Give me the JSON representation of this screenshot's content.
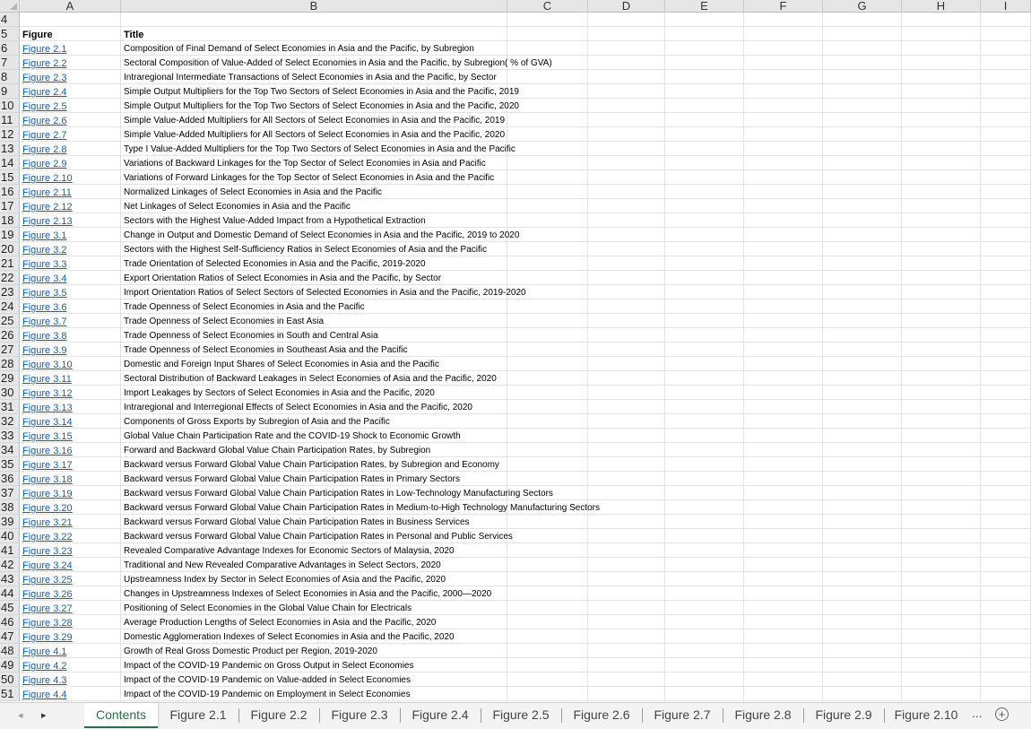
{
  "columns": [
    "A",
    "B",
    "C",
    "D",
    "E",
    "F",
    "G",
    "H",
    "I"
  ],
  "first_row_number": "4",
  "header_row": {
    "number": "5",
    "figure_label": "Figure",
    "title_label": "Title"
  },
  "rows": [
    {
      "number": "6",
      "figure": "Figure 2.1",
      "title": "Composition of Final Demand of Select Economies in Asia and the Pacific, by Subregion"
    },
    {
      "number": "7",
      "figure": "Figure 2.2",
      "title": "Sectoral Composition of Value-Added of Select Economies in Asia and the Pacific, by Subregion( % of GVA)"
    },
    {
      "number": "8",
      "figure": "Figure 2.3",
      "title": "Intraregional Intermediate Transactions of Select Economies in Asia and the Pacific, by Sector"
    },
    {
      "number": "9",
      "figure": "Figure 2.4",
      "title": "Simple Output Multipliers for the Top Two Sectors of Select Economies in Asia and the Pacific, 2019"
    },
    {
      "number": "10",
      "figure": "Figure 2.5",
      "title": "Simple Output Multipliers for the Top Two Sectors of Select Economies in Asia and the Pacific, 2020"
    },
    {
      "number": "11",
      "figure": "Figure 2.6",
      "title": "Simple Value-Added Multipliers for All Sectors of Select Economies in Asia and the Pacific, 2019"
    },
    {
      "number": "12",
      "figure": "Figure 2.7",
      "title": "Simple Value-Added Multipliers for All Sectors of Select Economies in Asia and the Pacific, 2020"
    },
    {
      "number": "13",
      "figure": "Figure 2.8",
      "title": "Type I Value-Added Multipliers for the Top Two Sectors of Select Economies in Asia and the Pacific"
    },
    {
      "number": "14",
      "figure": "Figure 2.9",
      "title": "Variations of Backward Linkages for the Top Sector of Select Economies in Asia and Pacific"
    },
    {
      "number": "15",
      "figure": "Figure 2.10",
      "title": "Variations of Forward Linkages for the Top Sector of Select Economies in Asia and the Pacific"
    },
    {
      "number": "16",
      "figure": "Figure 2.11",
      "title": "Normalized Linkages of Select Economies in Asia and the Pacific"
    },
    {
      "number": "17",
      "figure": "Figure 2.12",
      "title": "Net Linkages of Select Economies in Asia and the Pacific"
    },
    {
      "number": "18",
      "figure": "Figure 2.13",
      "title": "Sectors with the Highest Value-Added Impact from a Hypothetical Extraction"
    },
    {
      "number": "19",
      "figure": "Figure 3.1",
      "title": "Change in Output and Domestic Demand of Select Economies in Asia and the Pacific, 2019 to 2020"
    },
    {
      "number": "20",
      "figure": "Figure 3.2",
      "title": "Sectors with the Highest Self-Sufficiency Ratios in Select Economies of Asia and the Pacific"
    },
    {
      "number": "21",
      "figure": "Figure 3.3",
      "title": "Trade Orientation of Selected Economies in Asia and the Pacific, 2019-2020"
    },
    {
      "number": "22",
      "figure": "Figure 3.4",
      "title": "Export Orientation Ratios of Select Economies in Asia and the Pacific, by Sector"
    },
    {
      "number": "23",
      "figure": "Figure 3.5",
      "title": "Import Orientation Ratios of Select Sectors of Selected Economies in Asia and the Pacific, 2019-2020"
    },
    {
      "number": "24",
      "figure": "Figure 3.6",
      "title": "Trade Openness of Select Economies in Asia and the Pacific"
    },
    {
      "number": "25",
      "figure": "Figure 3.7",
      "title": "Trade Openness of Select Economies in East Asia"
    },
    {
      "number": "26",
      "figure": "Figure 3.8",
      "title": "Trade Openness of Select Economies in South and Central Asia"
    },
    {
      "number": "27",
      "figure": "Figure 3.9",
      "title": "Trade Openness of Select Economies in Southeast Asia and the Pacific"
    },
    {
      "number": "28",
      "figure": "Figure 3.10",
      "title": "Domestic and Foreign Input Shares of Select Economies in Asia and the Pacific"
    },
    {
      "number": "29",
      "figure": "Figure 3.11",
      "title": "Sectoral Distribution of Backward Leakages in Select Economies of Asia and the Pacific, 2020"
    },
    {
      "number": "30",
      "figure": "Figure 3.12",
      "title": "Import Leakages by Sectors of Select Economies in Asia and the Pacific, 2020"
    },
    {
      "number": "31",
      "figure": "Figure 3.13",
      "title": "Intraregional and Interregional Effects of Select Economies in Asia and the Pacific, 2020"
    },
    {
      "number": "32",
      "figure": "Figure 3.14",
      "title": "Components of Gross Exports by Subregion of Asia and the Pacific"
    },
    {
      "number": "33",
      "figure": "Figure 3.15",
      "title": "Global Value Chain Participation Rate and the COVID-19 Shock to Economic Growth"
    },
    {
      "number": "34",
      "figure": "Figure 3.16",
      "title": "Forward and Backward Global Value Chain Participation Rates, by Subregion"
    },
    {
      "number": "35",
      "figure": "Figure 3.17",
      "title": "Backward versus Forward Global Value Chain Participation Rates, by Subregion and Economy"
    },
    {
      "number": "36",
      "figure": "Figure 3.18",
      "title": "Backward versus Forward Global Value Chain Participation Rates in Primary Sectors"
    },
    {
      "number": "37",
      "figure": "Figure 3.19",
      "title": "Backward versus Forward Global Value Chain Participation Rates in Low-Technology Manufacturing Sectors"
    },
    {
      "number": "38",
      "figure": "Figure 3.20",
      "title": "Backward versus Forward Global Value Chain Participation Rates in Medium-to-High Technology Manufacturing Sectors"
    },
    {
      "number": "39",
      "figure": "Figure 3.21",
      "title": "Backward versus Forward Global Value Chain Participation Rates in Business Services"
    },
    {
      "number": "40",
      "figure": "Figure 3.22",
      "title": "Backward versus Forward Global Value Chain Participation Rates in Personal and Public Services"
    },
    {
      "number": "41",
      "figure": "Figure 3.23",
      "title": "Revealed Comparative Advantage Indexes for Economic Sectors of Malaysia, 2020"
    },
    {
      "number": "42",
      "figure": "Figure 3.24",
      "title": "Traditional and New Revealed Comparative Advantages in Select Sectors, 2020"
    },
    {
      "number": "43",
      "figure": "Figure 3.25",
      "title": "Upstreamness Index by Sector in Select Economies of Asia and the Pacific, 2020"
    },
    {
      "number": "44",
      "figure": "Figure 3.26",
      "title": "Changes in Upstreamness Indexes of Select Economies in Asia and the Pacific, 2000—2020"
    },
    {
      "number": "45",
      "figure": "Figure 3.27",
      "title": "Positioning of Select Economies in the Global Value Chain for Electricals"
    },
    {
      "number": "46",
      "figure": "Figure 3.28",
      "title": "Average Production Lengths of Select Economies in Asia and the Pacific, 2020"
    },
    {
      "number": "47",
      "figure": "Figure 3.29",
      "title": "Domestic Agglomeration Indexes of Select Economies in Asia and the Pacific, 2020"
    },
    {
      "number": "48",
      "figure": "Figure 4.1",
      "title": "Growth of Real Gross Domestic Product per Region, 2019-2020"
    },
    {
      "number": "49",
      "figure": "Figure 4.2",
      "title": "Impact of the COVID-19 Pandemic on Gross Output in Select Economies"
    },
    {
      "number": "50",
      "figure": "Figure 4.3",
      "title": "Impact of the COVID-19 Pandemic on Value-added in Select Economies"
    },
    {
      "number": "51",
      "figure": "Figure 4.4",
      "title": "Impact of the COVID-19 Pandemic on Employment in Select Economies"
    }
  ],
  "tabs": [
    "Contents",
    "Figure 2.1",
    "Figure 2.2",
    "Figure 2.3",
    "Figure 2.4",
    "Figure 2.5",
    "Figure 2.6",
    "Figure 2.7",
    "Figure 2.8",
    "Figure 2.9",
    "Figure 2.10"
  ],
  "active_tab": "Contents",
  "nav": {
    "prev": "◂",
    "next": "▸",
    "more": "...",
    "add": "+"
  },
  "colors": {
    "link": "#0563c1",
    "header_bg": "#e6e6e6",
    "active_tab": "#217346"
  }
}
